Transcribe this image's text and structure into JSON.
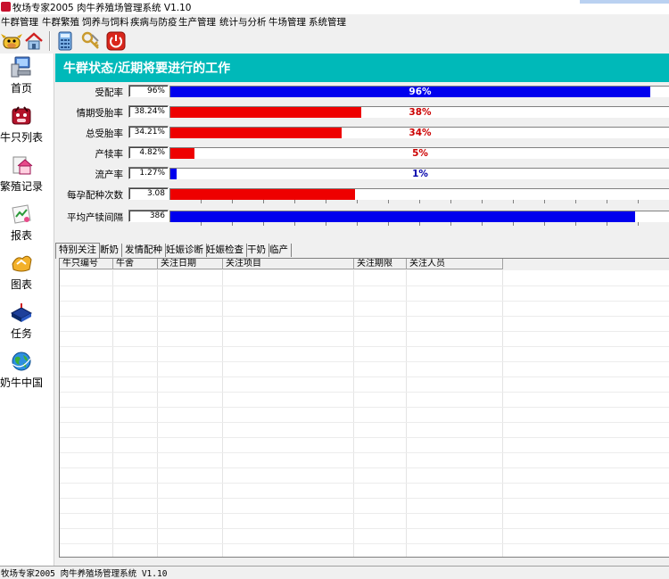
{
  "app": {
    "title": "牧场专家2005 肉牛养殖场管理系统 V1.10"
  },
  "menu": [
    "牛群管理",
    "牛群繁殖",
    "饲养与饲料",
    "疾病与防疫",
    "生产管理",
    "统计与分析",
    "牛场管理",
    "系统管理"
  ],
  "toolbar": {
    "icons": [
      "cow-face-icon",
      "home-icon",
      "calculator-icon",
      "keys-icon",
      "power-icon"
    ]
  },
  "nav": [
    {
      "label": "首页",
      "icon": "computer-icon"
    },
    {
      "label": "牛只列表",
      "icon": "cow-icon"
    },
    {
      "label": "繁殖记录",
      "icon": "house-icon"
    },
    {
      "label": "报表",
      "icon": "report-icon"
    },
    {
      "label": "图表",
      "icon": "chart-icon"
    },
    {
      "label": "任务",
      "icon": "book-icon"
    },
    {
      "label": "奶牛中国",
      "icon": "globe-icon"
    }
  ],
  "banner": {
    "title": "牛群状态/近期将要进行的工作"
  },
  "stats": [
    {
      "label": "受配率",
      "value": "96%",
      "bar_percent": "96%",
      "fraction": 0.96,
      "color": "#0000ee",
      "text_color": "#ffffff",
      "has_ticks": false
    },
    {
      "label": "情期受胎率",
      "value": "38.24%",
      "bar_percent": "38%",
      "fraction": 0.3824,
      "color": "#ee0000",
      "text_color": "#cc0000",
      "has_ticks": false
    },
    {
      "label": "总受胎率",
      "value": "34.21%",
      "bar_percent": "34%",
      "fraction": 0.3421,
      "color": "#ee0000",
      "text_color": "#cc0000",
      "has_ticks": false
    },
    {
      "label": "产犊率",
      "value": "4.82%",
      "bar_percent": "5%",
      "fraction": 0.0482,
      "color": "#ee0000",
      "text_color": "#cc0000",
      "has_ticks": false
    },
    {
      "label": "流产率",
      "value": "1.27%",
      "bar_percent": "1%",
      "fraction": 0.0127,
      "color": "#0000ee",
      "text_color": "#0000aa",
      "has_ticks": false
    },
    {
      "label": "每孕配种次数",
      "value": "3.08",
      "bar_percent": "",
      "fraction": 0.37,
      "color": "#ee0000",
      "text_color": "#cc0000",
      "has_ticks": true
    },
    {
      "label": "平均产犊间隔",
      "value": "386",
      "bar_percent": "",
      "fraction": 0.93,
      "color": "#0000ee",
      "text_color": "#0000aa",
      "has_ticks": true
    }
  ],
  "tabs": [
    "特别关注",
    "断奶",
    "发情配种",
    "妊娠诊断",
    "妊娠检查",
    "干奶",
    "临产"
  ],
  "active_tab": 0,
  "grid": {
    "columns": [
      "牛只编号",
      "牛舍",
      "关注日期",
      "关注项目",
      "关注期限",
      "关注人员"
    ]
  },
  "status": {
    "text": "牧场专家2005 肉牛养殖场管理系统 V1.10"
  }
}
